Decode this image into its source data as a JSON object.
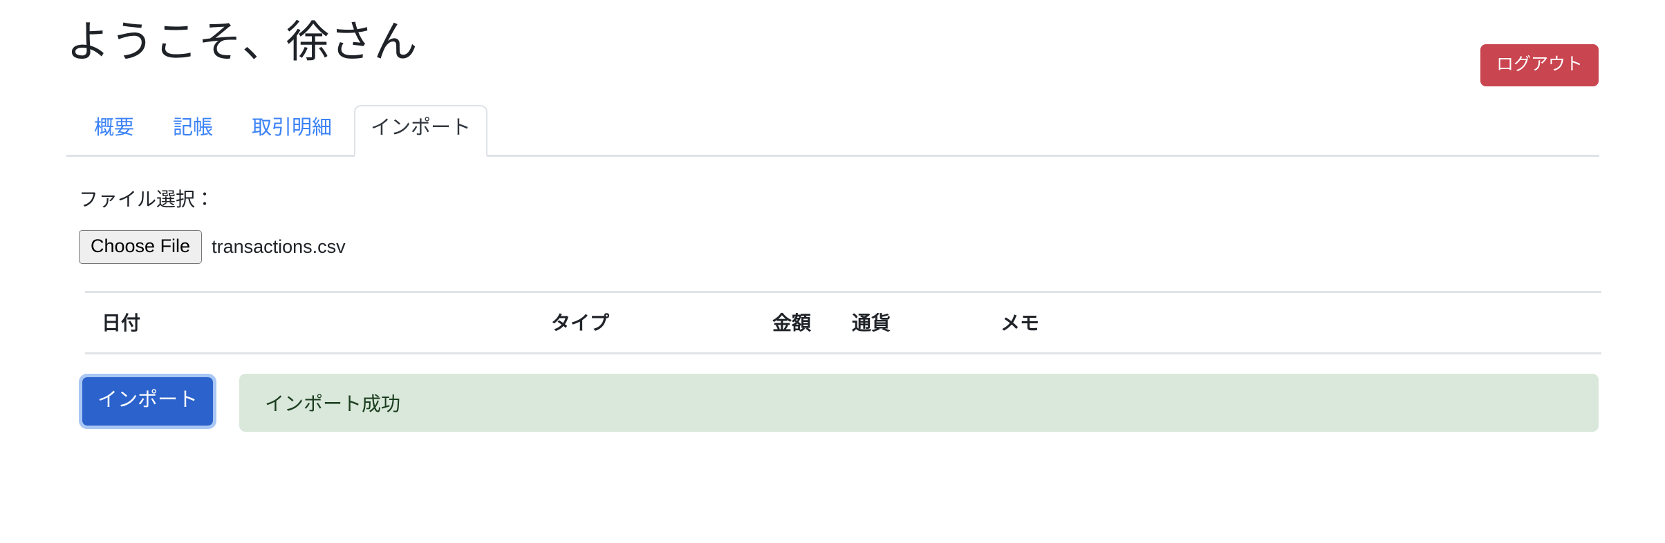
{
  "header": {
    "title": "ようこそ、徐さん",
    "logout_label": "ログアウト",
    "logout_color": "#c9454f"
  },
  "tabs": [
    {
      "label": "概要",
      "active": false
    },
    {
      "label": "記帳",
      "active": false
    },
    {
      "label": "取引明細",
      "active": false
    },
    {
      "label": "インポート",
      "active": true
    }
  ],
  "tab_link_color": "#3b82f6",
  "file_picker": {
    "label": "ファイル選択：",
    "button_label": "Choose File",
    "file_name": "transactions.csv"
  },
  "preview_table": {
    "columns": [
      "日付",
      "タイプ",
      "金額",
      "通貨",
      "メモ"
    ],
    "rows": []
  },
  "actions": {
    "import_label": "インポート",
    "import_color": "#2b62cb",
    "focus_ring_color": "#a8c7f4"
  },
  "status": {
    "message": "インポート成功",
    "background": "#d9e8da",
    "text_color": "#1b3d1f"
  }
}
